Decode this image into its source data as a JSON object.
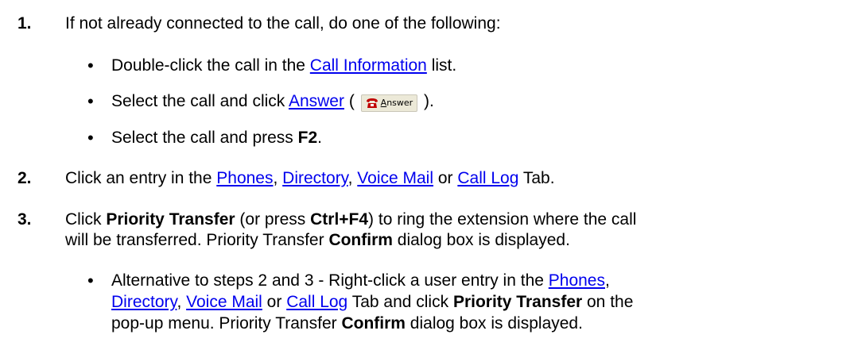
{
  "steps": [
    {
      "number": "1.",
      "text": "If not already connected to the call, do one of the following:",
      "bullets": [
        {
          "pre": "Double-click the call in the ",
          "link": "Call Information",
          "post": " list."
        },
        {
          "pre": "Select the call and click ",
          "link": "Answer",
          "mid": " ( ",
          "button_first_letter": "A",
          "button_rest": "nswer",
          "post": " )."
        },
        {
          "pre": "Select the call and press ",
          "bold": "F2",
          "post": "."
        }
      ]
    },
    {
      "number": "2.",
      "pre": "Click an entry in the ",
      "links": [
        "Phones",
        "Directory",
        "Voice Mail",
        "Call Log"
      ],
      "sep1": ", ",
      "sep2": ", ",
      "sep3": " or ",
      "post": " Tab."
    },
    {
      "number": "3.",
      "pre": "Click ",
      "bold1": "Priority Transfer",
      "mid1": " (or press ",
      "bold2": "Ctrl+F4",
      "mid2": ") to ring the extension where the call",
      "line2_pre": "will be transferred. Priority Transfer ",
      "line2_bold": "Confirm",
      "line2_post": " dialog box is displayed.",
      "bullet": {
        "line1_pre": "Alternative to steps 2 and 3 - Right-click a user entry in the ",
        "line1_link": "Phones",
        "line1_post": ",",
        "line2_link1": "Directory",
        "line2_sep1": ", ",
        "line2_link2": "Voice Mail",
        "line2_sep2": " or ",
        "line2_link3": "Call Log",
        "line2_mid": " Tab and click ",
        "line2_bold": "Priority Transfer",
        "line2_post": " on the",
        "line3_pre": "pop-up menu. Priority Transfer ",
        "line3_bold": "Confirm",
        "line3_post": " dialog box is displayed."
      }
    }
  ],
  "bullet_char": "•",
  "colors": {
    "link": "#0000ee",
    "text": "#000000"
  }
}
